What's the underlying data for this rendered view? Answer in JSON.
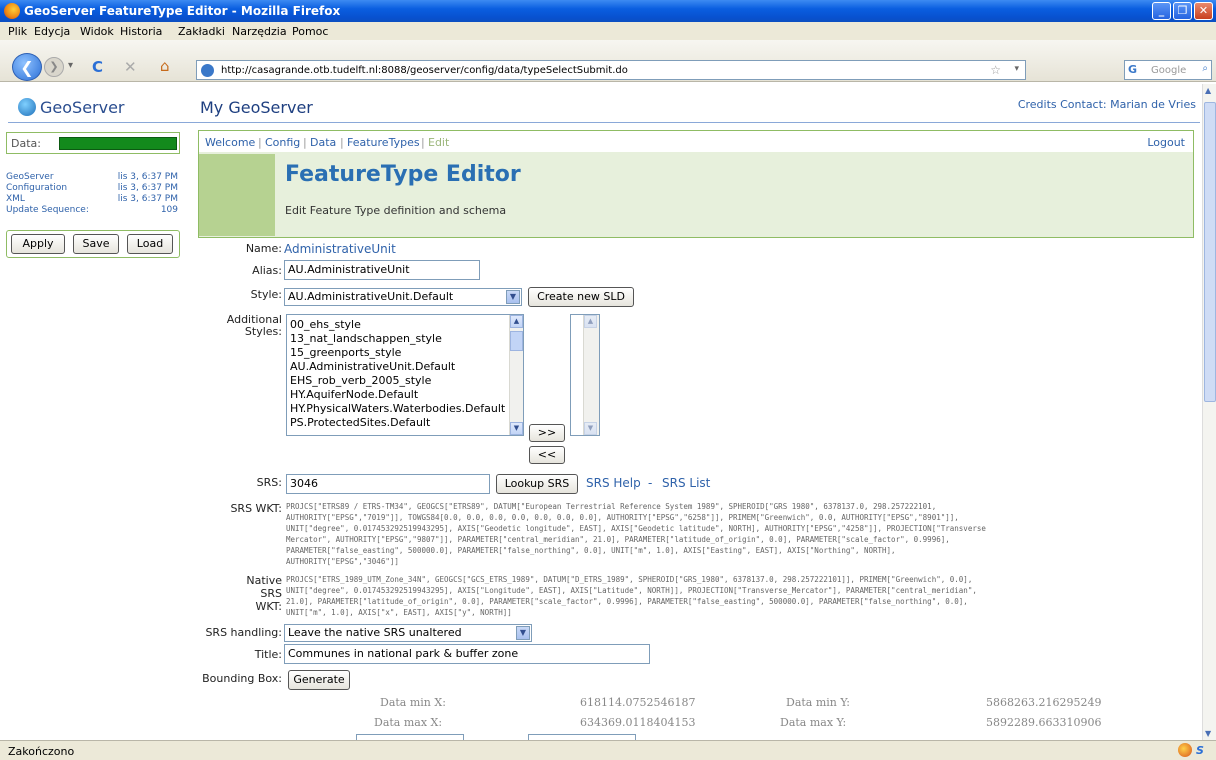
{
  "window": {
    "title": "GeoServer FeatureType Editor - Mozilla Firefox"
  },
  "menu": {
    "items": [
      "Plik",
      "Edycja",
      "Widok",
      "Historia",
      "Zakładki",
      "Narzędzia",
      "Pomoc"
    ]
  },
  "browser": {
    "url": "http://casagrande.otb.tudelft.nl:8088/geoserver/config/data/typeSelectSubmit.do",
    "search_placeholder": "Google",
    "status": "Zakończono"
  },
  "site": {
    "logo": "GeoServer",
    "heading": "My GeoServer",
    "credits": "Credits Contact: Marian de Vries"
  },
  "sidebar": {
    "data_label": "Data:",
    "stats": [
      {
        "key": "GeoServer",
        "value": "lis 3, 6:37 PM"
      },
      {
        "key": "Configuration",
        "value": "lis 3, 6:37 PM"
      },
      {
        "key": "XML",
        "value": "lis 3, 6:37 PM"
      },
      {
        "key": "Update Sequence:",
        "value": "109"
      }
    ],
    "buttons": {
      "apply": "Apply",
      "save": "Save",
      "load": "Load"
    }
  },
  "breadcrumb": {
    "items": [
      "Welcome",
      "Config",
      "Data",
      "FeatureTypes",
      "Edit"
    ],
    "logout": "Logout"
  },
  "header": {
    "title": "FeatureType Editor",
    "subtitle": "Edit Feature Type definition and schema"
  },
  "form": {
    "name_label": "Name:",
    "name_value": "AdministrativeUnit",
    "alias_label": "Alias:",
    "alias_value": "AU.AdministrativeUnit",
    "style_label": "Style:",
    "style_value": "AU.AdministrativeUnit.Default",
    "create_sld": "Create new SLD",
    "additional_styles_label": [
      "Additional",
      "Styles:"
    ],
    "additional_styles": [
      "00_ehs_style",
      "13_nat_landschappen_style",
      "15_greenports_style",
      "AU.AdministrativeUnit.Default",
      "EHS_rob_verb_2005_style",
      "HY.AquiferNode.Default",
      "HY.PhysicalWaters.Waterbodies.Default",
      "PS.ProtectedSites.Default"
    ],
    "add_btn": ">>",
    "remove_btn": "<<",
    "srs_label": "SRS:",
    "srs_value": "3046",
    "lookup_srs": "Lookup SRS",
    "srs_help": "SRS Help",
    "srs_dash": "-",
    "srs_list": "SRS List",
    "srs_wkt_label": "SRS WKT:",
    "srs_wkt_lines": [
      "PROJCS[\"ETRS89 / ETRS-TM34\", GEOGCS[\"ETRS89\", DATUM[\"European Terrestrial Reference System 1989\", SPHEROID[\"GRS 1980\", 6378137.0, 298.257222101,",
      "AUTHORITY[\"EPSG\",\"7019\"]], TOWGS84[0.0, 0.0, 0.0, 0.0, 0.0, 0.0, 0.0], AUTHORITY[\"EPSG\",\"6258\"]], PRIMEM[\"Greenwich\", 0.0, AUTHORITY[\"EPSG\",\"8901\"]],",
      "UNIT[\"degree\", 0.017453292519943295], AXIS[\"Geodetic longitude\", EAST], AXIS[\"Geodetic latitude\", NORTH], AUTHORITY[\"EPSG\",\"4258\"]], PROJECTION[\"Transverse",
      "Mercator\", AUTHORITY[\"EPSG\",\"9807\"]], PARAMETER[\"central_meridian\", 21.0], PARAMETER[\"latitude_of_origin\", 0.0], PARAMETER[\"scale_factor\", 0.9996],",
      "PARAMETER[\"false_easting\", 500000.0], PARAMETER[\"false_northing\", 0.0], UNIT[\"m\", 1.0], AXIS[\"Easting\", EAST], AXIS[\"Northing\", NORTH],",
      "AUTHORITY[\"EPSG\",\"3046\"]]"
    ],
    "native_wkt_label": [
      "Native SRS",
      "WKT:"
    ],
    "native_wkt_lines": [
      "PROJCS[\"ETRS_1989_UTM_Zone_34N\", GEOGCS[\"GCS_ETRS_1989\", DATUM[\"D_ETRS_1989\", SPHEROID[\"GRS_1980\", 6378137.0, 298.257222101]], PRIMEM[\"Greenwich\", 0.0],",
      "UNIT[\"degree\", 0.017453292519943295], AXIS[\"Longitude\", EAST], AXIS[\"Latitude\", NORTH]], PROJECTION[\"Transverse_Mercator\"], PARAMETER[\"central_meridian\",",
      "21.0], PARAMETER[\"latitude_of_origin\", 0.0], PARAMETER[\"scale_factor\", 0.9996], PARAMETER[\"false_easting\", 500000.0], PARAMETER[\"false_northing\", 0.0],",
      "UNIT[\"m\", 1.0], AXIS[\"x\", EAST], AXIS[\"y\", NORTH]]"
    ],
    "srs_handling_label": "SRS handling:",
    "srs_handling_value": "Leave the native SRS unaltered",
    "title_label": "Title:",
    "title_value": "Communes in national park & buffer zone",
    "bbox_label": "Bounding Box:",
    "generate": "Generate",
    "bbox": {
      "min_x_label": "Data min X:",
      "min_x": "618114.0752546187",
      "min_y_label": "Data min Y:",
      "min_y": "5868263.216295249",
      "max_x_label": "Data max X:",
      "max_x": "634369.0118404153",
      "max_y_label": "Data max Y:",
      "max_y": "5892289.663310906"
    }
  }
}
